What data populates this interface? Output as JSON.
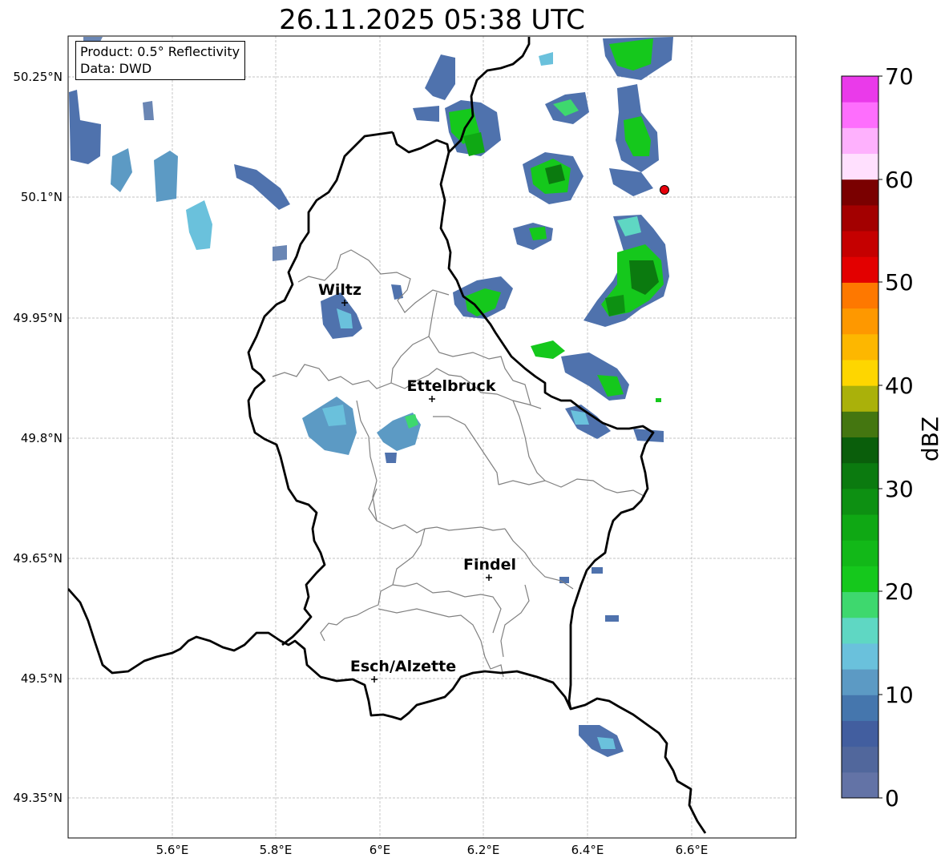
{
  "title": "26.11.2025 05:38 UTC",
  "info_box": {
    "product_line": "Product: 0.5° Reflectivity",
    "source_line": "Data: DWD"
  },
  "axes": {
    "lat_ticks": [
      "50.25°N",
      "50.1°N",
      "49.95°N",
      "49.8°N",
      "49.65°N",
      "49.5°N",
      "49.35°N"
    ],
    "lon_ticks": [
      "5.6°E",
      "5.8°E",
      "6°E",
      "6.2°E",
      "6.4°E",
      "6.6°E"
    ],
    "grid": true
  },
  "cities": [
    {
      "name": "Wiltz",
      "lon": 5.93,
      "lat": 49.966
    },
    {
      "name": "Ettelbruck",
      "lon": 6.1,
      "lat": 49.847
    },
    {
      "name": "Findel",
      "lon": 6.21,
      "lat": 49.626
    },
    {
      "name": "Esch/Alzette",
      "lon": 5.99,
      "lat": 49.499
    }
  ],
  "radar_marker": {
    "color": "#e8000b",
    "lon": 6.55,
    "lat": 50.11
  },
  "colorbar": {
    "title": "dBZ",
    "range": [
      0,
      70
    ],
    "tick_labels": [
      "0",
      "10",
      "20",
      "30",
      "40",
      "50",
      "60",
      "70"
    ],
    "colors": [
      "#6373a6",
      "#51679c",
      "#425e9f",
      "#4576ad",
      "#5c9ac4",
      "#6ac1dc",
      "#5fd7c3",
      "#3ed86e",
      "#15c81c",
      "#12b818",
      "#0fa814",
      "#0d9012",
      "#0b7a0f",
      "#0a5e0b",
      "#447610",
      "#aab10a",
      "#fed600",
      "#fdb700",
      "#fe9800",
      "#fe7800",
      "#e30000",
      "#c50000",
      "#a30000",
      "#7a0000",
      "#ffe0fe",
      "#feb1fd",
      "#fe6efd",
      "#ea3aea"
    ]
  }
}
